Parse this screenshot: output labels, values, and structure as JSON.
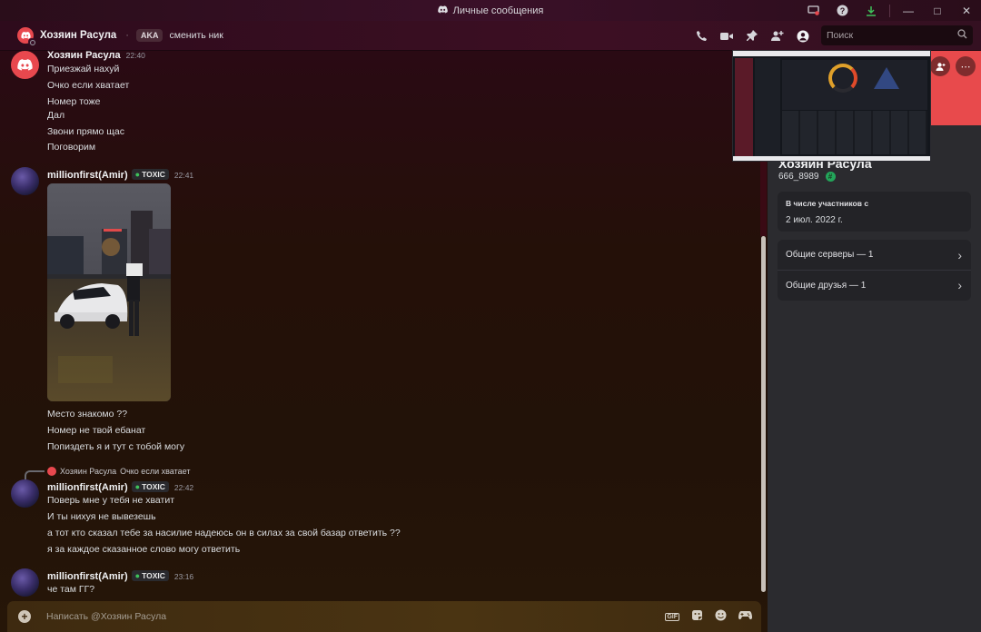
{
  "window": {
    "title": "Личные сообщения"
  },
  "header": {
    "name": "Хозяин Расула",
    "aka": "AKA",
    "change_nick": "сменить ник",
    "search_placeholder": "Поиск"
  },
  "messages": [
    {
      "author": "Хозяин Расула",
      "time": "22:40",
      "lines": [
        "Приезжай нахуй",
        "Очко если хватает",
        "Номер тоже",
        "Дал",
        "Звони прямо щас",
        "Поговорим"
      ]
    },
    {
      "author": "millionfirst(Amir)",
      "tag": "TOXIC",
      "time": "22:41",
      "lines": [
        "Место знакомо ??",
        "Номер не твой ебанат",
        "Попиздеть я и тут с тобой могу"
      ]
    },
    {
      "reply_author": "Хозяин Расула",
      "reply_text": "Очко если хватает",
      "author": "millionfirst(Amir)",
      "tag": "TOXIC",
      "time": "22:42",
      "lines": [
        "Поверь мне у тебя не хватит",
        "И ты нихуя не вывезешь",
        "а тот кто сказал тебе за насилие надеюсь он в силах за свой базар ответить ??",
        "я за каждое сказанное слово могу ответить"
      ]
    },
    {
      "author": "millionfirst(Amir)",
      "tag": "TOXIC",
      "time": "23:16",
      "lines": [
        "че там ГГ?"
      ]
    }
  ],
  "composer": {
    "placeholder": "Написать @Хозяин Расула",
    "gif_label": "GIF"
  },
  "profile": {
    "name": "Хозяин Расула",
    "username": "666_8989",
    "member_since_label": "В числе участников с",
    "member_since": "2 июл. 2022 г.",
    "mutual_servers": "Общие серверы — 1",
    "mutual_friends": "Общие друзья — 1",
    "banner_color": "#e84a4c"
  }
}
